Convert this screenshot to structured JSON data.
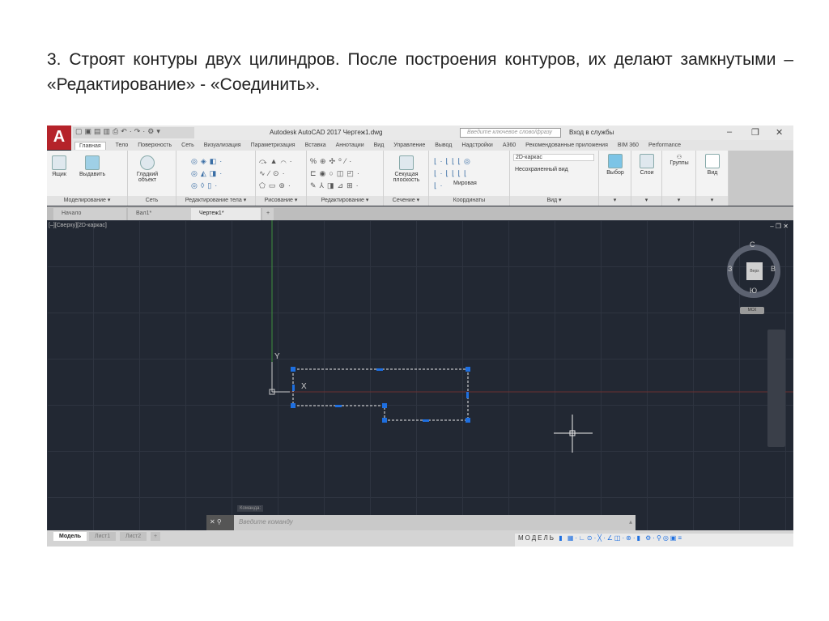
{
  "heading": "3. Строят контуры двух цилиндров. После построения контуров, их делают замкнутыми – «Редактирование» - «Соединить».",
  "app": {
    "logo": "A",
    "title": "Autodesk AutoCAD 2017   Чертеж1.dwg",
    "search_placeholder": "Введите ключевое слово/фразу",
    "signin": "Вход в службы",
    "window": {
      "min": "–",
      "max": "❐",
      "close": "✕"
    }
  },
  "tabs": [
    "Главная",
    "Тело",
    "Поверхность",
    "Сеть",
    "Визуализация",
    "Параметризация",
    "Вставка",
    "Аннотации",
    "Вид",
    "Управление",
    "Вывод",
    "Надстройки",
    "A360",
    "Рекомендованные приложения",
    "BIM 360",
    "Performance"
  ],
  "ribbon": {
    "tools": {
      "box": "Ящик",
      "extrude": "Выдавить",
      "smooth": "Гладкий объект",
      "section_plane": "Секущая плоскость",
      "visual_style": "2D-каркас",
      "view": "Несохраненный вид",
      "ucs": "Мировая",
      "select": "Выбор",
      "layers": "Слои",
      "groups": "Группы",
      "view_panel": "Вид"
    },
    "panels": [
      "Моделирование ▾",
      "Сеть",
      "Редактирование тела ▾",
      "Рисование ▾",
      "Редактирование ▾",
      "Сечение ▾",
      "Координаты",
      "Вид ▾",
      "▾",
      "▾",
      "▾",
      "▾"
    ]
  },
  "doc_tabs": [
    "Начало",
    "Вал1*",
    "Чертеж1*",
    "+"
  ],
  "viewport": {
    "label": "[–][Сверху][2D-каркас]",
    "controls": "– ❐ ✕",
    "cube": {
      "face": "Верх",
      "n": "С",
      "s": "Ю",
      "e": "В",
      "w": "З",
      "ucs": "МСК"
    },
    "axis_y": "Y",
    "axis_x": "X"
  },
  "command": {
    "label": "Команда:",
    "placeholder": "Введите команду"
  },
  "layout_tabs": [
    "Модель",
    "Лист1",
    "Лист2",
    "+"
  ],
  "status": {
    "mode": "МОДЕЛЬ"
  },
  "colors": {
    "canvas": "#222833",
    "grip": "#1e6fe0",
    "logo": "#b5232a"
  }
}
